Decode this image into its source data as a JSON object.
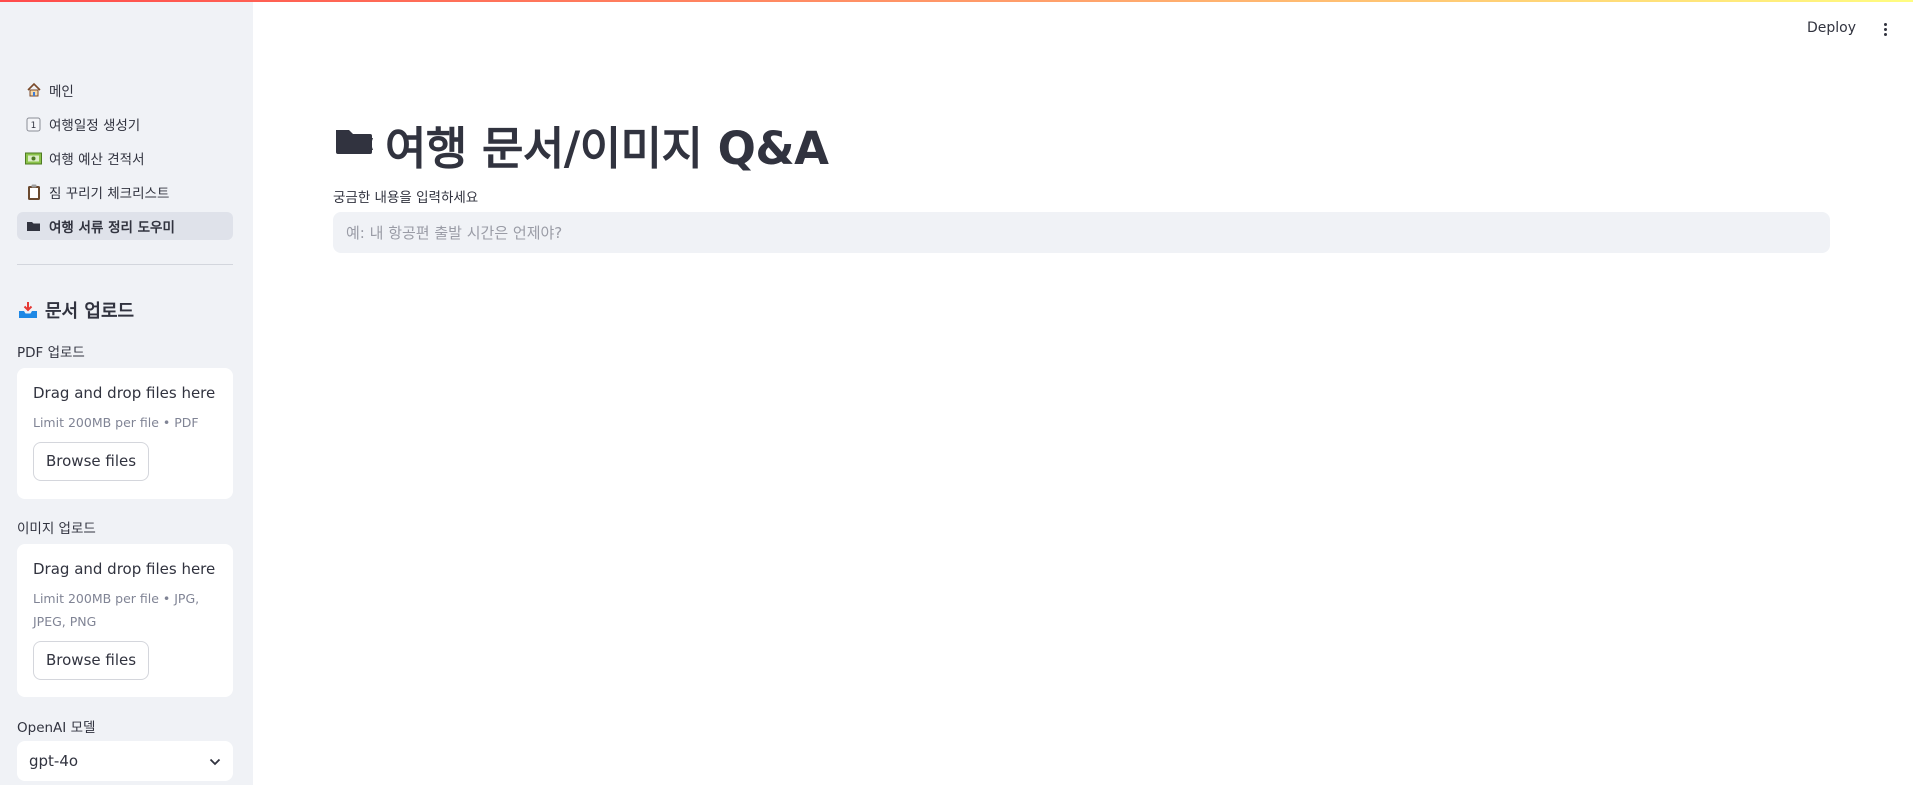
{
  "sidebar": {
    "nav": [
      {
        "label": "메인",
        "icon": "house-icon"
      },
      {
        "label": "여행일정 생성기",
        "icon": "keycap-one-icon"
      },
      {
        "label": "여행 예산 견적서",
        "icon": "money-icon"
      },
      {
        "label": "짐 꾸리기 체크리스트",
        "icon": "clipboard-icon"
      },
      {
        "label": "여행 서류 정리 도우미",
        "icon": "folder-icon",
        "active": true
      }
    ],
    "upload_section": {
      "title": "문서 업로드",
      "icon": "inbox-tray-icon"
    },
    "pdf_uploader": {
      "label": "PDF 업로드",
      "drop_text": "Drag and drop files here",
      "limit_text": "Limit 200MB per file • PDF",
      "browse_label": "Browse files"
    },
    "image_uploader": {
      "label": "이미지 업로드",
      "drop_text": "Drag and drop files here",
      "limit_text": "Limit 200MB per file • JPG, JPEG, PNG",
      "browse_label": "Browse files"
    },
    "model_select": {
      "label": "OpenAI 모델",
      "value": "gpt-4o"
    }
  },
  "header": {
    "deploy_label": "Deploy"
  },
  "main": {
    "title": "여행 문서/이미지 Q&A",
    "title_icon": "folder-icon",
    "question_label": "궁금한 내용을 입력하세요",
    "question_placeholder": "예: 내 항공편 출발 시간은 언제야?"
  },
  "colors": {
    "accent_gradient_start": "#ff4b4b",
    "accent_gradient_end": "#fffd80",
    "sidebar_bg": "#f0f2f6",
    "text": "#31333f",
    "muted": "#808495"
  }
}
